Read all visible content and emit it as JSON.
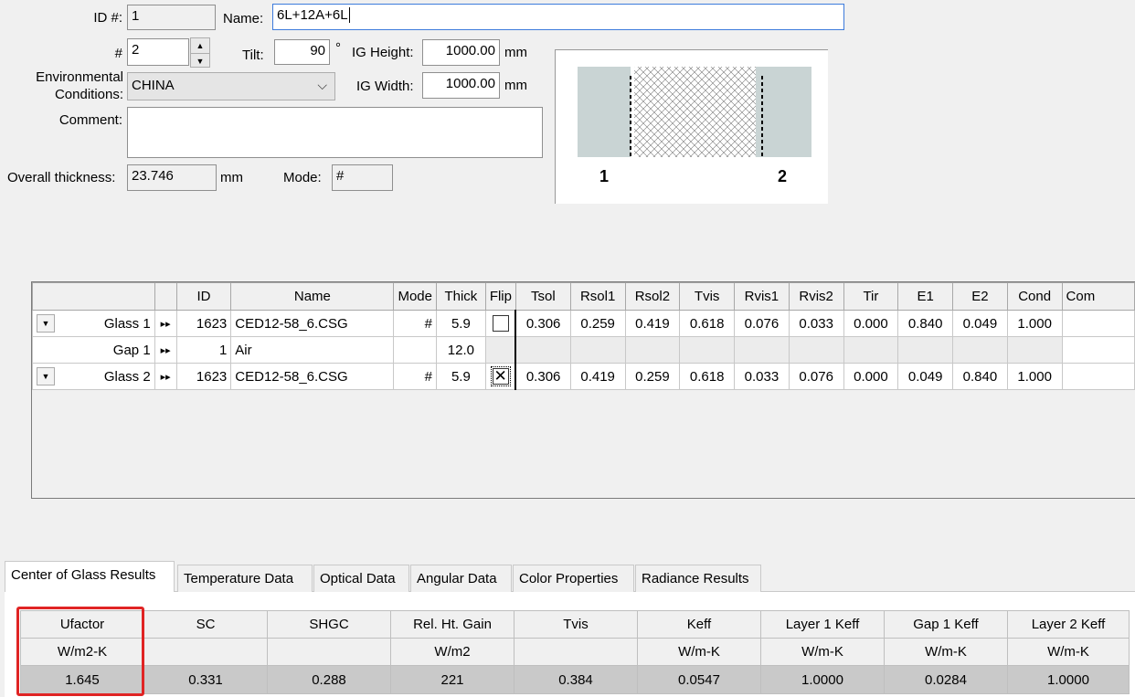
{
  "form": {
    "id_label": "ID #:",
    "id_value": "1",
    "name_label": "Name:",
    "name_value": "6L+12A+6L",
    "num_label": "#",
    "num_value": "2",
    "tilt_label": "Tilt:",
    "tilt_value": "90",
    "tilt_unit": "°",
    "ig_height_label": "IG Height:",
    "ig_height_value": "1000.00",
    "ig_height_unit": "mm",
    "ig_width_label": "IG Width:",
    "ig_width_value": "1000.00",
    "ig_width_unit": "mm",
    "env_label_line1": "Environmental",
    "env_label_line2": "Conditions:",
    "env_value": "CHINA",
    "comment_label": "Comment:",
    "comment_value": "",
    "thickness_label": "Overall thickness:",
    "thickness_value": "23.746",
    "thickness_unit": "mm",
    "mode_label": "Mode:",
    "mode_value": "#"
  },
  "preview": {
    "label_left": "1",
    "label_right": "2",
    "glass_color": "#c9d4d4"
  },
  "layers": {
    "columns": [
      "",
      "",
      "ID",
      "Name",
      "Mode",
      "Thick",
      "Flip",
      "Tsol",
      "Rsol1",
      "Rsol2",
      "Tvis",
      "Rvis1",
      "Rvis2",
      "Tir",
      "E1",
      "E2",
      "Cond",
      "Com"
    ],
    "rows": [
      {
        "label": "Glass 1",
        "arrows": "▸▸",
        "id": "1623",
        "name": "CED12-58_6.CSG",
        "mode": "#",
        "thick": "5.9",
        "flip": "",
        "tsol": "0.306",
        "rsol1": "0.259",
        "rsol2": "0.419",
        "tvis": "0.618",
        "rvis1": "0.076",
        "rvis2": "0.033",
        "tir": "0.000",
        "e1": "0.840",
        "e2": "0.049",
        "cond": "1.000"
      },
      {
        "label": "Gap 1",
        "arrows": "▸▸",
        "id": "1",
        "name": "Air",
        "mode": "",
        "thick": "12.0"
      },
      {
        "label": "Glass 2",
        "arrows": "▸▸",
        "id": "1623",
        "name": "CED12-58_6.CSG",
        "mode": "#",
        "thick": "5.9",
        "flip": "✕",
        "tsol": "0.306",
        "rsol1": "0.419",
        "rsol2": "0.259",
        "tvis": "0.618",
        "rvis1": "0.033",
        "rvis2": "0.076",
        "tir": "0.000",
        "e1": "0.049",
        "e2": "0.840",
        "cond": "1.000"
      }
    ]
  },
  "tabs": [
    "Center of Glass Results",
    "Temperature Data",
    "Optical Data",
    "Angular Data",
    "Color Properties",
    "Radiance Results"
  ],
  "results": {
    "headers": [
      "Ufactor",
      "SC",
      "SHGC",
      "Rel. Ht. Gain",
      "Tvis",
      "Keff",
      "Layer 1 Keff",
      "Gap 1 Keff",
      "Layer 2 Keff"
    ],
    "units": [
      "W/m2-K",
      "",
      "",
      "W/m2",
      "",
      "W/m-K",
      "W/m-K",
      "W/m-K",
      "W/m-K"
    ],
    "values": [
      "1.645",
      "0.331",
      "0.288",
      "221",
      "0.384",
      "0.0547",
      "1.0000",
      "0.0284",
      "1.0000"
    ]
  },
  "highlight_color": "#e02424"
}
